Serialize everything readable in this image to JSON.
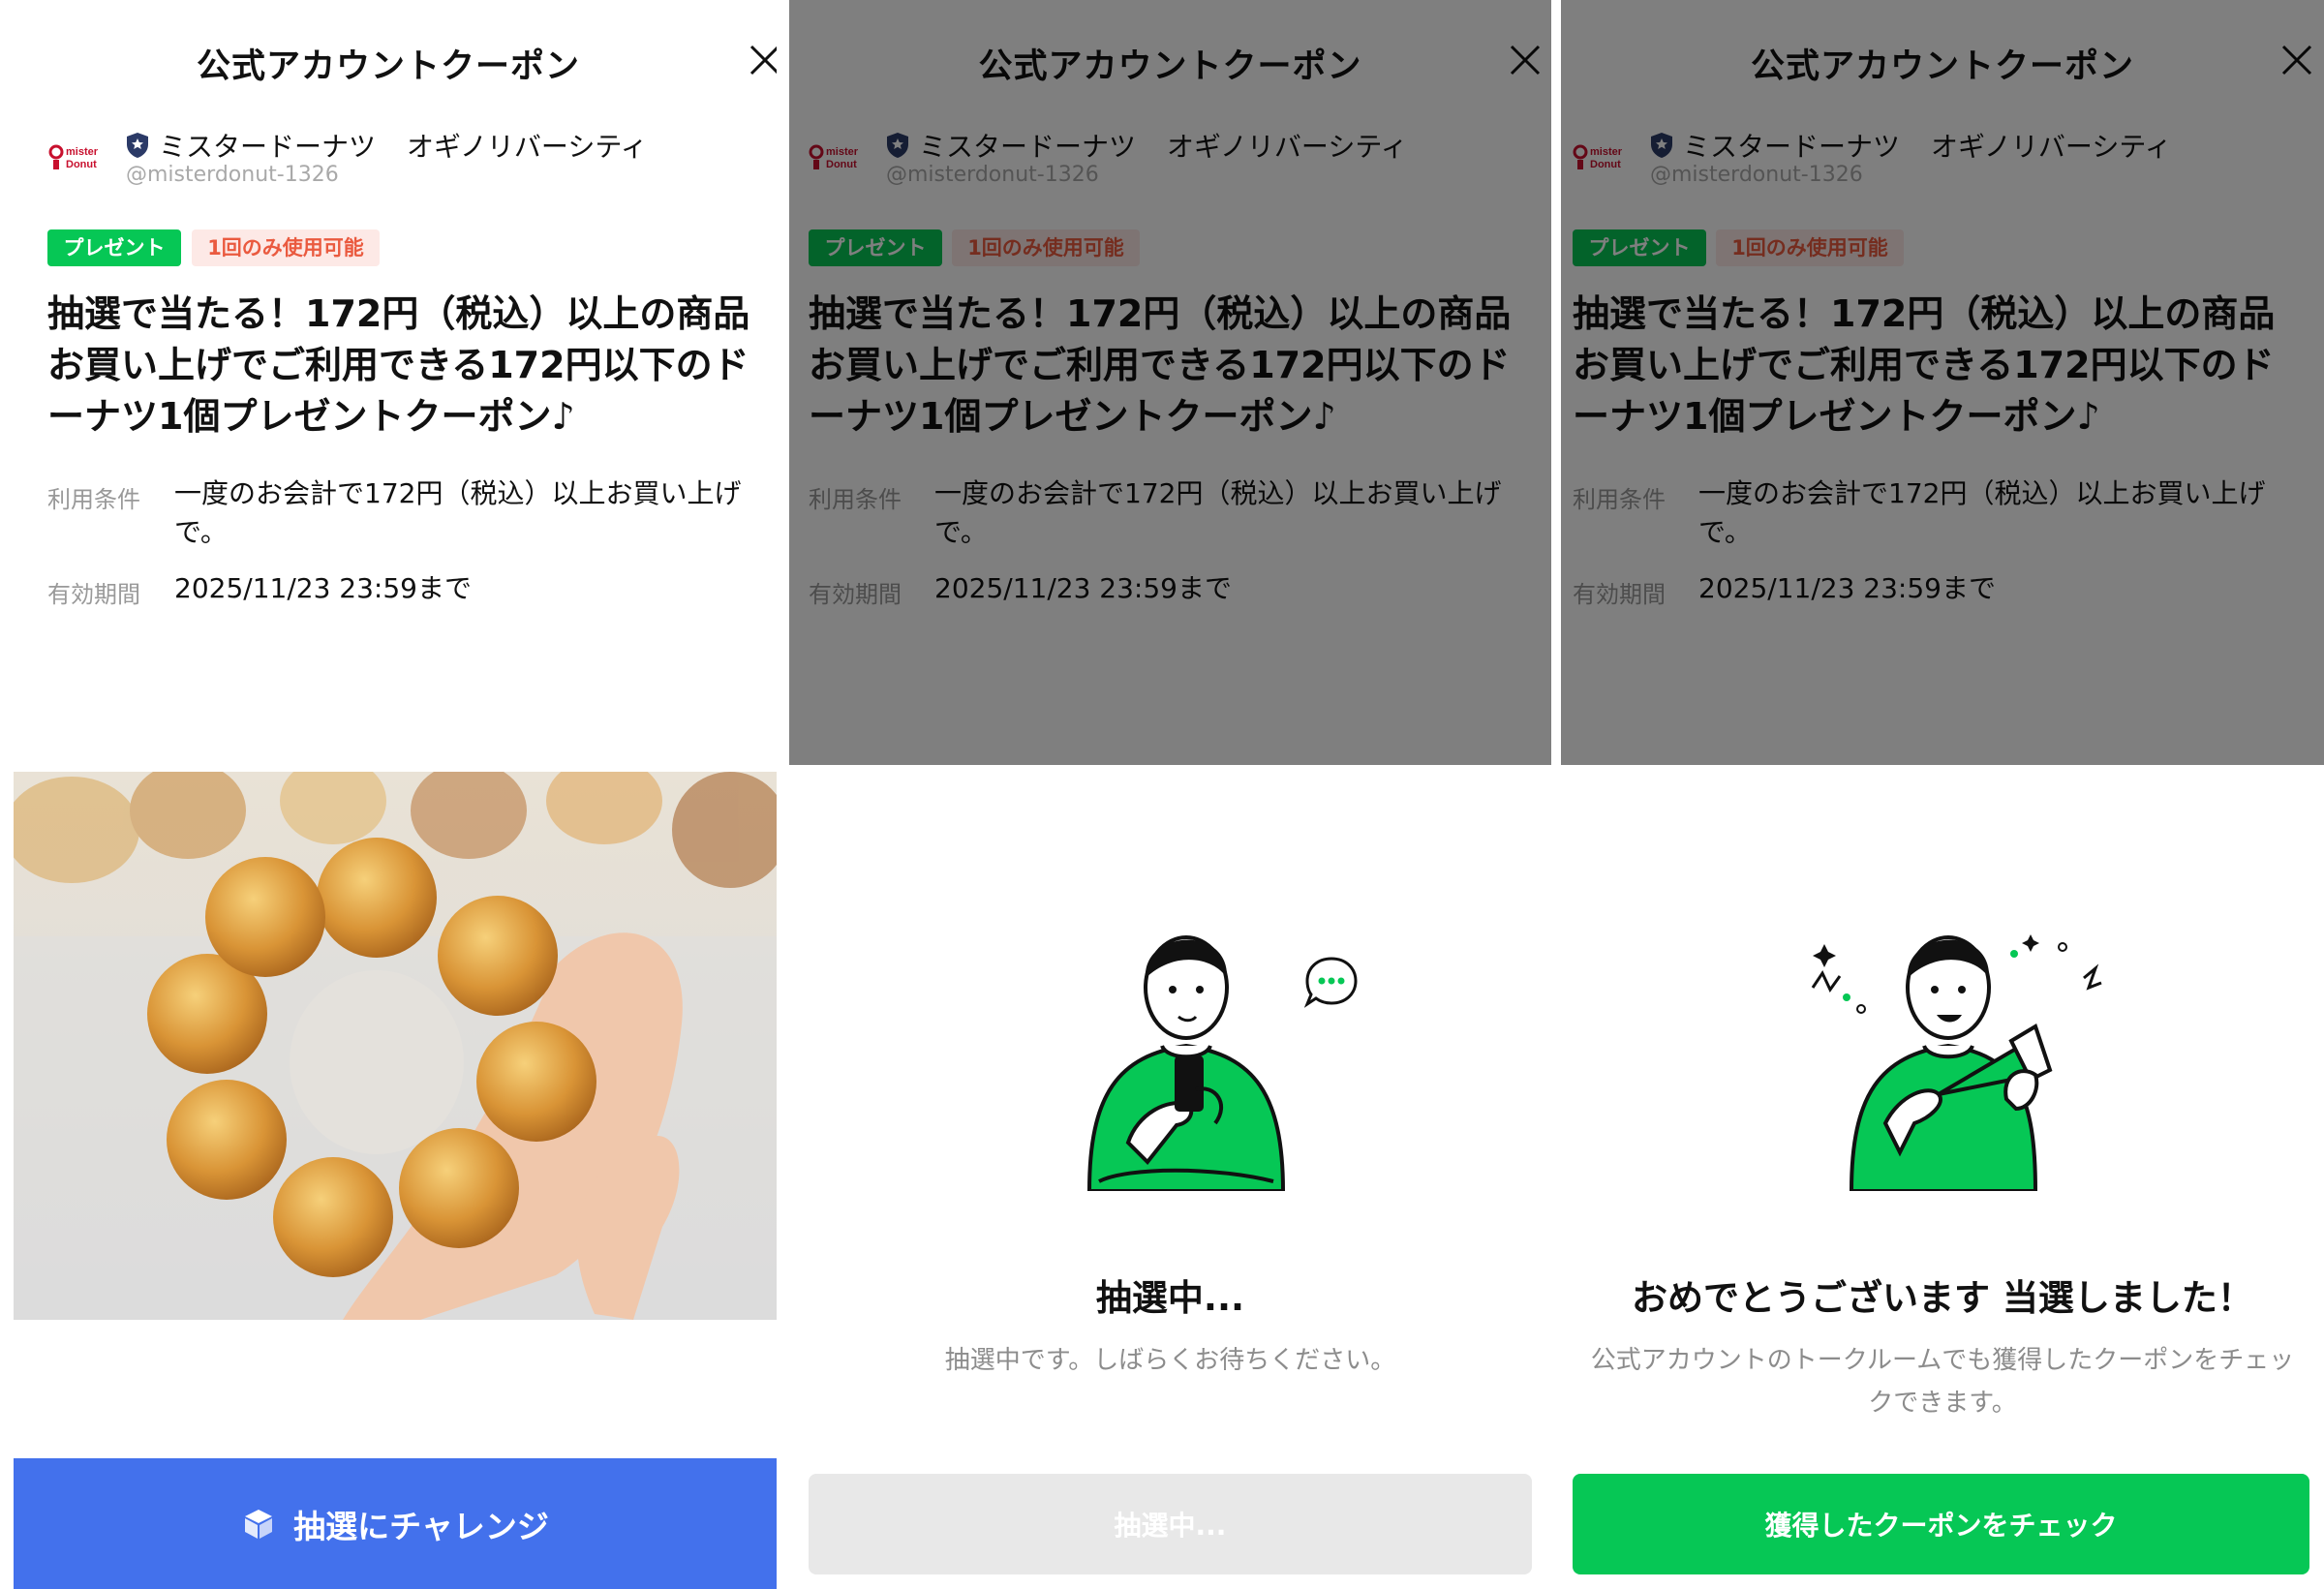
{
  "coupon": {
    "header_title": "公式アカウントクーポン",
    "account_name": "ミスタードーナツ",
    "store_name": "オギノリバーシティ",
    "handle": "@misterdonut-1326",
    "logo_text_line1": "mister",
    "logo_text_line2": "Donut",
    "badge_present": "プレゼント",
    "badge_once": "1回のみ使用可能",
    "title": "抽選で当たる！172円（税込）以上の商品お買い上げでご利用できる172円以下のドーナツ1個プレゼントクーポン♪",
    "conditions_label": "利用条件",
    "conditions_value": "一度のお会計で172円（税込）以上お買い上げで。",
    "expiry_label": "有効期間",
    "expiry_value": "2025/11/23 23:59まで"
  },
  "panel1": {
    "cta_label": "抽選にチャレンジ"
  },
  "panel2": {
    "status_title": "抽選中...",
    "status_sub": "抽選中です。しばらくお待ちください。",
    "button_label": "抽選中..."
  },
  "panel3": {
    "status_title": "おめでとうございます 当選しました！",
    "status_sub": "公式アカウントのトークルームでも獲得したクーポンをチェックできます。",
    "button_label": "獲得したクーポンをチェック"
  },
  "colors": {
    "line_green": "#06c755",
    "cta_blue": "#4371ec",
    "badge_once_text": "#ea5a3f",
    "overlay": "rgba(0,0,0,0.5)"
  },
  "icons": [
    "close-icon",
    "shield-icon",
    "cube-icon",
    "speech-bubble-icon"
  ]
}
